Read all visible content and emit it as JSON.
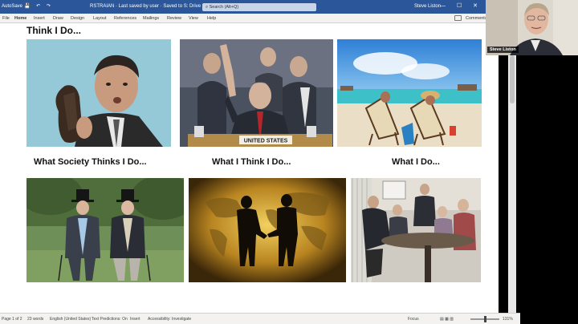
{
  "titlebar": {
    "autosave": "AutoSave",
    "doc_title": "RSTRAIAN · Last saved by user · Saved to S: Drive",
    "search_placeholder": "Search (Alt+Q)",
    "user": "Steve Liston",
    "window_controls": "—  ☐  ✕"
  },
  "ribbon": {
    "tabs": [
      "File",
      "Home",
      "Insert",
      "Draw",
      "Design",
      "Layout",
      "References",
      "Mailings",
      "Review",
      "View",
      "Help"
    ],
    "comments": "Comments"
  },
  "slide": {
    "top_heading": "Think I Do...",
    "captions": [
      "What Society Thinks I Do...",
      "What I Think I Do...",
      "What I Do..."
    ],
    "placard_text": "UNITED STATES"
  },
  "statusbar": {
    "page": "Page 1 of 2",
    "words": "23 words",
    "language": "English (United States)",
    "text_predictions": "Text Predictions: On",
    "insert": "Insert",
    "accessibility": "Accessibility: Investigate",
    "focus": "Focus",
    "zoom": "131%"
  },
  "webcam": {
    "name": "Steve Liston"
  },
  "colors": {
    "title_bar": "#2b579a",
    "ribbon": "#f3f2f1"
  }
}
